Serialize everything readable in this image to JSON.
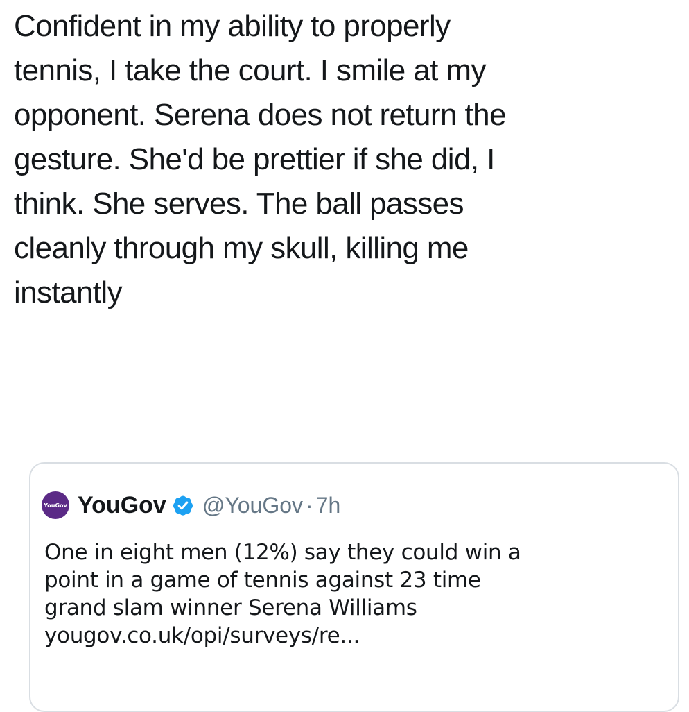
{
  "tweet": {
    "lines": [
      "Confident in my ability to properly",
      "tennis, I take the court. I smile at my",
      "opponent. Serena does not return the",
      "gesture. She'd be prettier if she did, I",
      "think. She serves. The ball passes",
      "cleanly through my skull, killing me",
      "instantly"
    ]
  },
  "quoted_tweet": {
    "avatar_text": "YouGov",
    "avatar_color": "#5b2a86",
    "display_name": "YouGov",
    "verified_icon": "verified-badge-icon",
    "verified_color": "#1da1f2",
    "handle": "@YouGov",
    "separator": "·",
    "time": "7h",
    "text_lines": [
      "One in eight men (12%) say they could win a",
      "point in a game of tennis against 23 time",
      "grand slam winner Serena Williams"
    ],
    "link": "yougov.co.uk/opi/surveys/re..."
  }
}
